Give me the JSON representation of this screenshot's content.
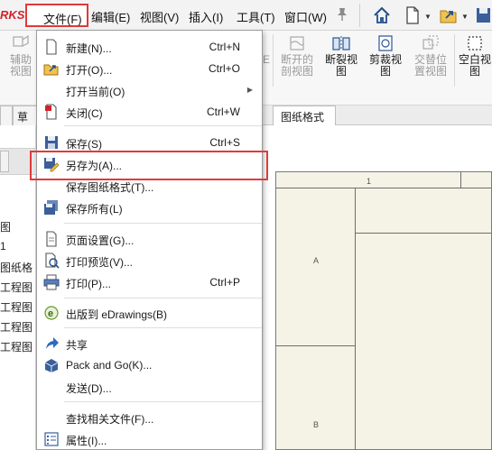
{
  "menubar": {
    "brand": "RKS",
    "file": "文件(F)",
    "edit": "编辑(E)",
    "view": "视图(V)",
    "insert": "插入(I)",
    "tools": "工具(T)",
    "window": "窗口(W)",
    "icons": [
      "pin-icon",
      "home-icon",
      "new-document-icon",
      "open-folder-icon"
    ]
  },
  "ribbon": {
    "auxiliary_view": "辅助视图",
    "broken_section": "断开的剖视图",
    "break_view": "断裂视图",
    "crop_view": "剪裁视图",
    "alternate_position": "交替位置视图",
    "blank_view": "空白视图",
    "partial_letter": "E"
  },
  "tabs": {
    "left_partial": "草",
    "sheet_format": "图纸格式"
  },
  "tree": {
    "items": [
      "图",
      "1",
      "图纸格",
      "工程图",
      "工程图",
      "工程图",
      "工程图"
    ]
  },
  "sheet": {
    "zone_a": "A",
    "zone_b": "B",
    "zone_1": "1"
  },
  "file_menu": {
    "new": {
      "label": "新建(N)...",
      "shortcut": "Ctrl+N"
    },
    "open": {
      "label": "打开(O)...",
      "shortcut": "Ctrl+O"
    },
    "open_recent": {
      "label": "打开当前(O)"
    },
    "close": {
      "label": "关闭(C)",
      "shortcut": "Ctrl+W"
    },
    "save": {
      "label": "保存(S)",
      "shortcut": "Ctrl+S"
    },
    "save_as": {
      "label": "另存为(A)..."
    },
    "save_sheet_format": {
      "label": "保存图纸格式(T)..."
    },
    "save_all": {
      "label": "保存所有(L)"
    },
    "page_setup": {
      "label": "页面设置(G)..."
    },
    "print_preview": {
      "label": "打印预览(V)..."
    },
    "print": {
      "label": "打印(P)...",
      "shortcut": "Ctrl+P"
    },
    "publish_edrawings": {
      "label": "出版到 eDrawings(B)"
    },
    "share": {
      "label": "共享"
    },
    "pack_and_go": {
      "label": "Pack and Go(K)..."
    },
    "send": {
      "label": "发送(D)..."
    },
    "find_references": {
      "label": "查找相关文件(F)..."
    },
    "properties": {
      "label": "属性(I)..."
    }
  }
}
